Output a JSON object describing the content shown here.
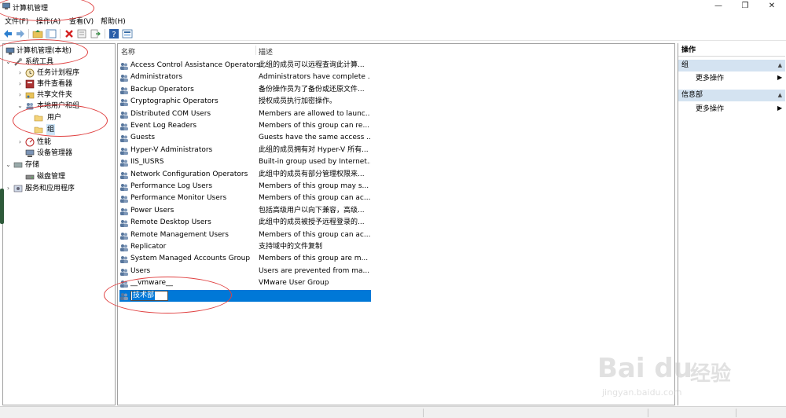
{
  "window": {
    "title": "计算机管理",
    "min": "—",
    "max": "❐",
    "close": "✕"
  },
  "menu": [
    "文件(F)",
    "操作(A)",
    "查看(V)",
    "帮助(H)"
  ],
  "toolbar": [
    "back-icon",
    "forward-icon",
    "up-folder-icon",
    "show-hide-tree-icon",
    "delete-icon",
    "properties-icon",
    "export-icon",
    "help-icon",
    "view-icon"
  ],
  "tree": [
    {
      "label": "计算机管理(本地)",
      "expander": "",
      "icon": "computer-management-icon"
    },
    {
      "label": "系统工具",
      "expander": "⌄",
      "icon": "tools-icon"
    },
    {
      "label": "任务计划程序",
      "expander": "›",
      "icon": "clock-icon"
    },
    {
      "label": "事件查看器",
      "expander": "›",
      "icon": "event-viewer-icon"
    },
    {
      "label": "共享文件夹",
      "expander": "›",
      "icon": "shared-folder-icon"
    },
    {
      "label": "本地用户和组",
      "expander": "⌄",
      "icon": "users-icon"
    },
    {
      "label": "用户",
      "expander": "",
      "icon": "folder-icon"
    },
    {
      "label": "组",
      "expander": "",
      "icon": "folder-icon"
    },
    {
      "label": "性能",
      "expander": "›",
      "icon": "performance-icon"
    },
    {
      "label": "设备管理器",
      "expander": "",
      "icon": "device-manager-icon"
    },
    {
      "label": "存储",
      "expander": "⌄",
      "icon": "storage-icon"
    },
    {
      "label": "磁盘管理",
      "expander": "",
      "icon": "disk-icon"
    },
    {
      "label": "服务和应用程序",
      "expander": "›",
      "icon": "services-icon"
    }
  ],
  "list": {
    "columns": [
      "名称",
      "描述"
    ],
    "rows": [
      {
        "name": "Access Control Assistance Operators",
        "desc": "此组的成员可以远程查询此计算..."
      },
      {
        "name": "Administrators",
        "desc": "Administrators have complete ..."
      },
      {
        "name": "Backup Operators",
        "desc": "备份操作员为了备份或还原文件..."
      },
      {
        "name": "Cryptographic Operators",
        "desc": "授权成员执行加密操作。"
      },
      {
        "name": "Distributed COM Users",
        "desc": "Members are allowed to launc..."
      },
      {
        "name": "Event Log Readers",
        "desc": "Members of this group can re..."
      },
      {
        "name": "Guests",
        "desc": "Guests have the same access ..."
      },
      {
        "name": "Hyper-V Administrators",
        "desc": "此组的成员拥有对 Hyper-V 所有..."
      },
      {
        "name": "IIS_IUSRS",
        "desc": "Built-in group used by Internet..."
      },
      {
        "name": "Network Configuration Operators",
        "desc": "此组中的成员有部分管理权限来..."
      },
      {
        "name": "Performance Log Users",
        "desc": "Members of this group may s..."
      },
      {
        "name": "Performance Monitor Users",
        "desc": "Members of this group can ac..."
      },
      {
        "name": "Power Users",
        "desc": "包括高级用户以向下兼容，高级..."
      },
      {
        "name": "Remote Desktop Users",
        "desc": "此组中的成员被授予远程登录的..."
      },
      {
        "name": "Remote Management Users",
        "desc": "Members of this group can ac..."
      },
      {
        "name": "Replicator",
        "desc": "支持域中的文件复制"
      },
      {
        "name": "System Managed Accounts Group",
        "desc": "Members of this group are m..."
      },
      {
        "name": "Users",
        "desc": "Users are prevented from ma..."
      },
      {
        "name": "__vmware__",
        "desc": "VMware User Group"
      }
    ],
    "editing_row": {
      "name": "技术部",
      "desc": ""
    }
  },
  "actions": {
    "title": "操作",
    "sections": [
      {
        "title": "组",
        "item": "更多操作"
      },
      {
        "title": "信息部",
        "item": "更多操作"
      }
    ]
  },
  "watermark": {
    "brand": "Bai du",
    "cn": "经验",
    "url": "jingyan.baidu.com"
  }
}
